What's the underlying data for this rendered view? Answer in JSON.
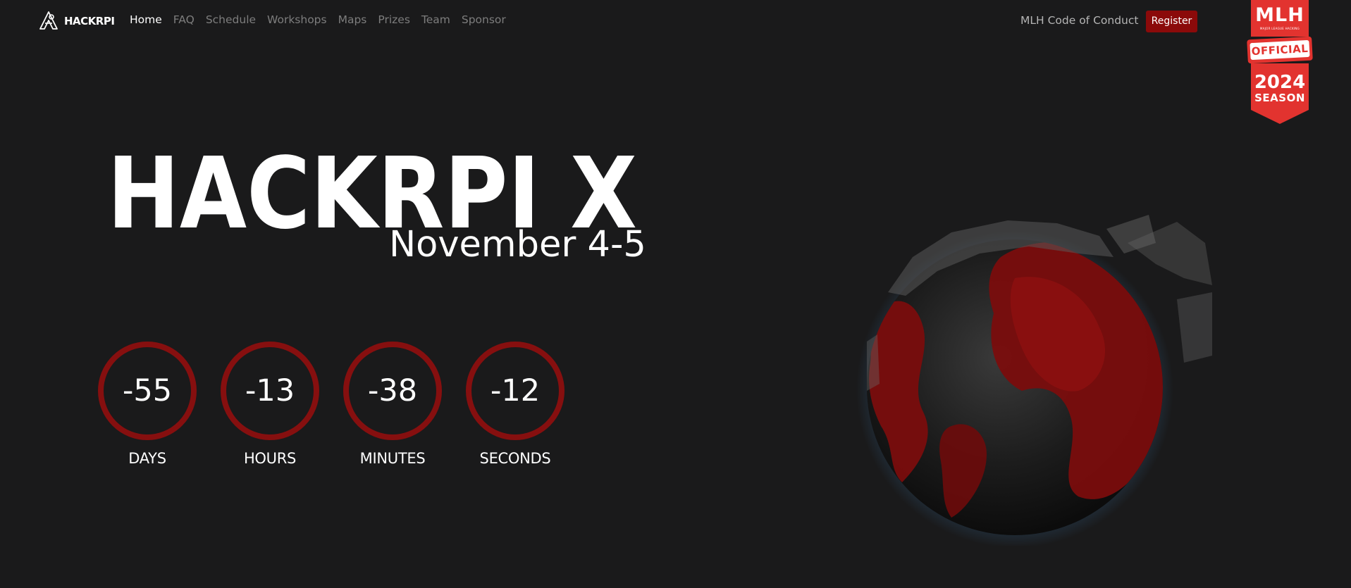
{
  "nav": {
    "brand": "HACKRPI",
    "links": [
      "Home",
      "FAQ",
      "Schedule",
      "Workshops",
      "Maps",
      "Prizes",
      "Team",
      "Sponsor"
    ],
    "active_link": "Home",
    "code_of_conduct": "MLH Code of Conduct",
    "register": "Register"
  },
  "mlh_badge": {
    "title": "MLH",
    "subtitle": "MAJOR LEAGUE HACKING",
    "official": "OFFICIAL",
    "year": "2024",
    "season": "SEASON"
  },
  "hero": {
    "title": "HACKRPI X",
    "date": "November 4-5"
  },
  "countdown": [
    {
      "value": "-55",
      "label": "DAYS"
    },
    {
      "value": "-13",
      "label": "HOURS"
    },
    {
      "value": "-38",
      "label": "MINUTES"
    },
    {
      "value": "-12",
      "label": "SECONDS"
    }
  ],
  "colors": {
    "background": "#1a1a1b",
    "accent": "#860f0f",
    "register": "#8b0a0a",
    "mlh_red": "#e2332f",
    "nav_inactive": "#7d7d7d"
  },
  "icons": {
    "brand_logo": "hackrpi-logo-icon",
    "globe": "globe-illustration"
  }
}
